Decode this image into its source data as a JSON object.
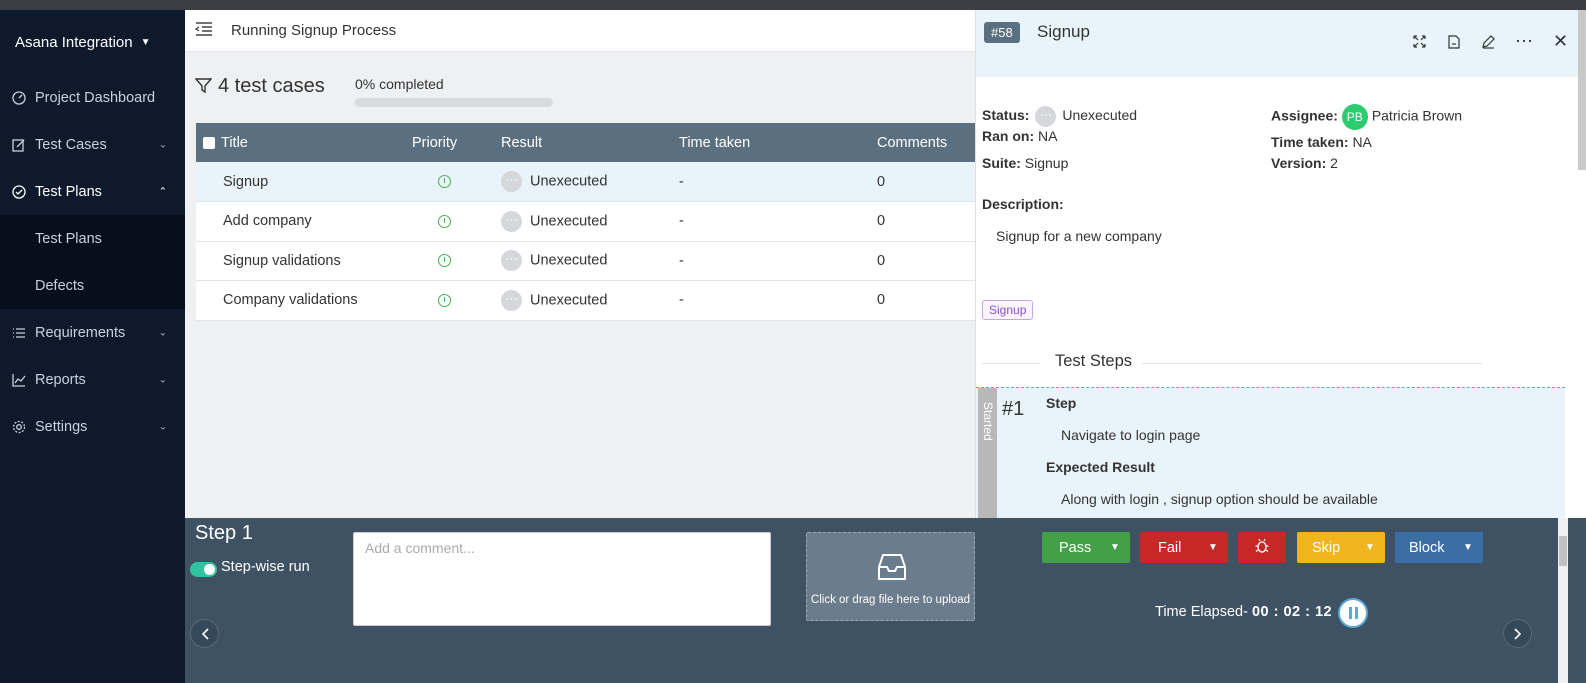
{
  "sidebar": {
    "brand": "Asana Integration",
    "items": [
      {
        "label": "Project Dashboard"
      },
      {
        "label": "Test Cases"
      },
      {
        "label": "Test Plans"
      },
      {
        "label": "Test Plans"
      },
      {
        "label": "Defects"
      },
      {
        "label": "Requirements"
      },
      {
        "label": "Reports"
      },
      {
        "label": "Settings"
      }
    ]
  },
  "header": {
    "title": "Running Signup Process"
  },
  "summary": {
    "count": "4 test cases",
    "progress_label": "0% completed",
    "progress": 0
  },
  "table": {
    "columns": [
      "Title",
      "Priority",
      "Result",
      "Time taken",
      "Comments"
    ],
    "rows": [
      {
        "title": "Signup",
        "result": "Unexecuted",
        "time": "-",
        "comments": "0"
      },
      {
        "title": "Add company",
        "result": "Unexecuted",
        "time": "-",
        "comments": "0"
      },
      {
        "title": "Signup validations",
        "result": "Unexecuted",
        "time": "-",
        "comments": "0"
      },
      {
        "title": "Company validations",
        "result": "Unexecuted",
        "time": "-",
        "comments": "0"
      }
    ]
  },
  "detail": {
    "id": "#58",
    "title": "Signup",
    "status_label": "Status:",
    "status": "Unexecuted",
    "ran_on_label": "Ran on:",
    "ran_on": "NA",
    "suite_label": "Suite:",
    "suite": "Signup",
    "assignee_label": "Assignee:",
    "assignee_initials": "PB",
    "assignee": "Patricia Brown",
    "time_taken_label": "Time taken:",
    "time_taken": "NA",
    "version_label": "Version:",
    "version": "2",
    "description_label": "Description:",
    "description": "Signup for a new company",
    "tag": "Signup",
    "steps_title": "Test Steps",
    "step": {
      "state": "Started",
      "number": "#1",
      "step_label": "Step",
      "step_text": "Navigate to login page",
      "expected_label": "Expected Result",
      "expected_text": "Along with login , signup option should be available"
    }
  },
  "runner": {
    "step_label": "Step 1",
    "toggle_label": "Step-wise run",
    "comment_placeholder": "Add a comment...",
    "upload_text": "Click or drag file here to upload",
    "buttons": {
      "pass": "Pass",
      "fail": "Fail",
      "skip": "Skip",
      "block": "Block"
    },
    "elapsed_label": "Time Elapsed-",
    "elapsed_value": "00 : 02 : 12"
  },
  "colors": {
    "sidebar_bg": "#0e1a2c",
    "pass": "#43a047",
    "fail": "#c62828",
    "skip": "#f2b51e",
    "block": "#3c6ea6",
    "header_row": "#5a7080"
  }
}
